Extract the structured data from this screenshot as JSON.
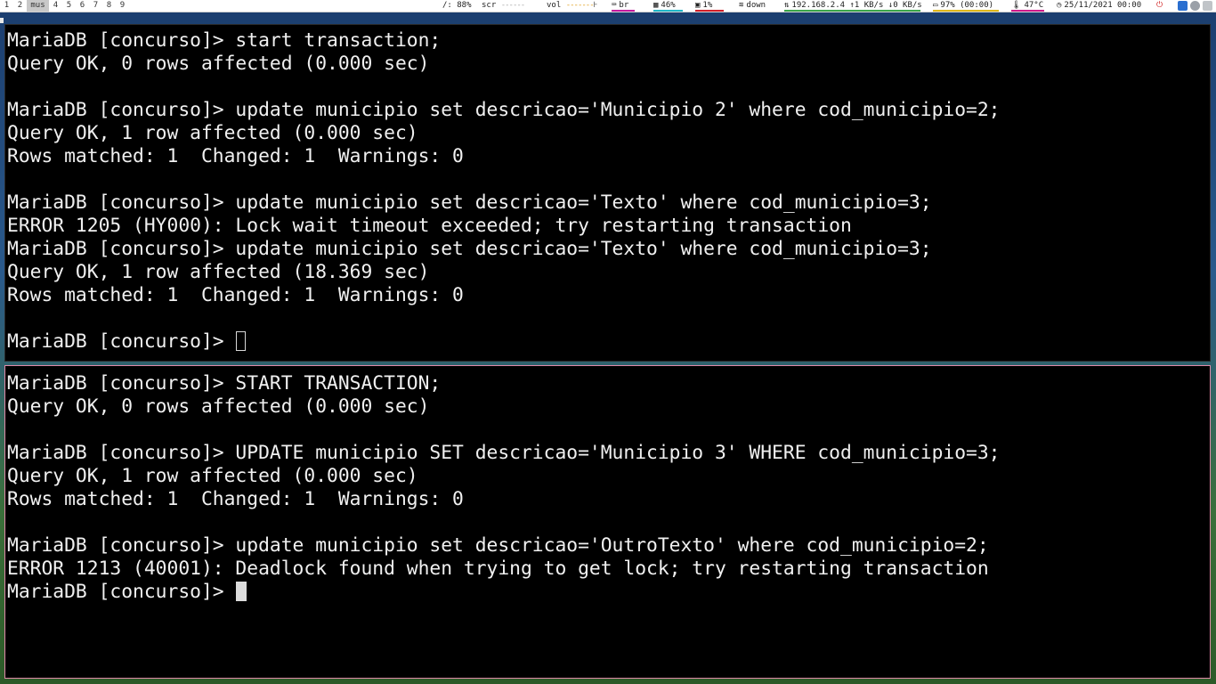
{
  "statusbar": {
    "workspaces": [
      "1",
      "2",
      "mus",
      "4",
      "5",
      "6",
      "7",
      "8",
      "9"
    ],
    "brightness": "/: 88%",
    "screen_label": "scr",
    "volume_label": "vol",
    "keyboard_layout": "br",
    "memory": "46%",
    "cpu": "1%",
    "wifi": "down",
    "network": "192.168.2.4 ↑1 KB/s ↓0 KB/s",
    "battery": "97% (00:00)",
    "temperature": "47°C",
    "datetime": "25/11/2021 00:00",
    "colors": {
      "keyboard": "#c51aa0",
      "memory": "#1fb8c9",
      "cpu": "#d4202a",
      "network": "#3aa64a",
      "battery": "#e0b81a",
      "temperature": "#d01a8c",
      "power": "#d02020"
    },
    "icons": [
      "keyboard-icon",
      "memory-icon",
      "cpu-icon",
      "wifi-icon",
      "network-icon",
      "battery-icon",
      "thermometer-icon",
      "clock-icon",
      "power-icon"
    ]
  },
  "terminal_top": {
    "lines": [
      "MariaDB [concurso]> start transaction;",
      "Query OK, 0 rows affected (0.000 sec)",
      "",
      "MariaDB [concurso]> update municipio set descricao='Municipio 2' where cod_municipio=2;",
      "Query OK, 1 row affected (0.000 sec)",
      "Rows matched: 1  Changed: 1  Warnings: 0",
      "",
      "MariaDB [concurso]> update municipio set descricao='Texto' where cod_municipio=3;",
      "ERROR 1205 (HY000): Lock wait timeout exceeded; try restarting transaction",
      "MariaDB [concurso]> update municipio set descricao='Texto' where cod_municipio=3;",
      "Query OK, 1 row affected (18.369 sec)",
      "Rows matched: 1  Changed: 1  Warnings: 0",
      "",
      "MariaDB [concurso]> "
    ]
  },
  "terminal_bottom": {
    "lines": [
      "MariaDB [concurso]> START TRANSACTION;",
      "Query OK, 0 rows affected (0.000 sec)",
      "",
      "MariaDB [concurso]> UPDATE municipio SET descricao='Municipio 3' WHERE cod_municipio=3;",
      "Query OK, 1 row affected (0.000 sec)",
      "Rows matched: 1  Changed: 1  Warnings: 0",
      "",
      "MariaDB [concurso]> update municipio set descricao='OutroTexto' where cod_municipio=2;",
      "ERROR 1213 (40001): Deadlock found when trying to get lock; try restarting transaction",
      "MariaDB [concurso]> "
    ]
  }
}
